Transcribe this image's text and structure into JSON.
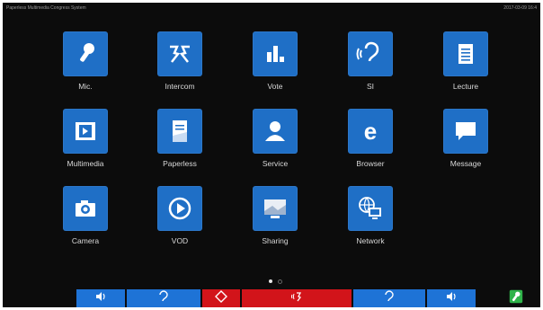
{
  "topbar": {
    "title": "Paperless Multimedia Congress System",
    "time": "2017-03-09 16:4"
  },
  "apps": [
    {
      "label": "Mic.",
      "icon": "microphone-icon"
    },
    {
      "label": "Intercom",
      "icon": "intercom-icon"
    },
    {
      "label": "Vote",
      "icon": "bar-chart-icon"
    },
    {
      "label": "SI",
      "icon": "ear-icon"
    },
    {
      "label": "Lecture",
      "icon": "notepad-icon"
    },
    {
      "label": "Multimedia",
      "icon": "film-icon"
    },
    {
      "label": "Paperless",
      "icon": "document-icon"
    },
    {
      "label": "Service",
      "icon": "person-icon"
    },
    {
      "label": "Browser",
      "icon": "browser-e-icon"
    },
    {
      "label": "Message",
      "icon": "speech-bubble-icon"
    },
    {
      "label": "Camera",
      "icon": "camera-icon"
    },
    {
      "label": "VOD",
      "icon": "play-icon"
    },
    {
      "label": "Sharing",
      "icon": "screen-share-icon"
    },
    {
      "label": "Network",
      "icon": "globe-network-icon"
    }
  ],
  "pager": {
    "pages": 2,
    "current": 1
  },
  "bottom_bar": {
    "buttons": [
      {
        "icon": "speaker-icon",
        "color": "#1e73d6"
      },
      {
        "icon": "ear-icon",
        "color": "#1e73d6"
      },
      {
        "icon": "diamond-icon",
        "color": "#d2141a"
      },
      {
        "icon": "intercom-icon",
        "color": "#d2141a"
      },
      {
        "icon": "ear-icon",
        "color": "#1e73d6"
      },
      {
        "icon": "speaker-icon",
        "color": "#1e73d6"
      },
      {
        "icon": "microphone-icon",
        "color": "#2fb34a"
      }
    ]
  },
  "colors": {
    "tile": "#1f6fc6",
    "background": "#0c0c0c"
  }
}
